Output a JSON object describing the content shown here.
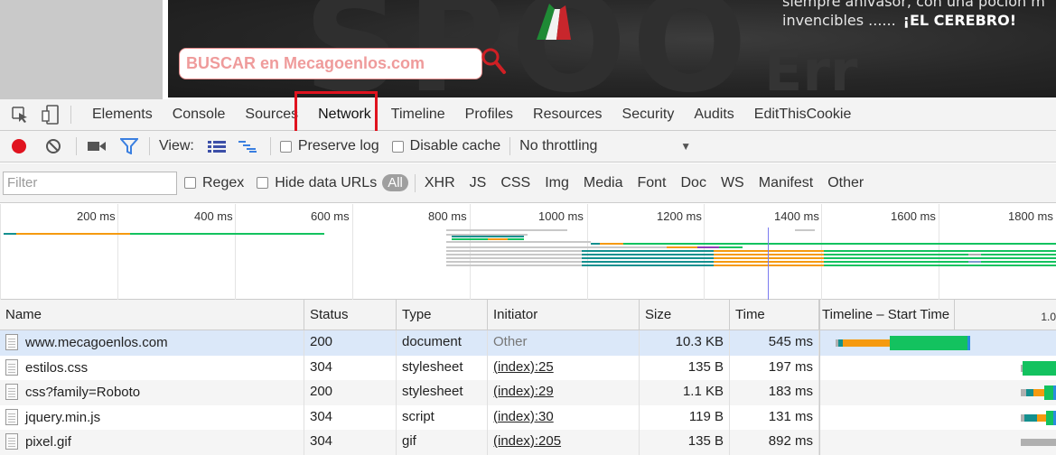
{
  "banner": {
    "bg_text": "SPOO",
    "bg_text2": "Err",
    "line1": "siempre ahivasor, con una pocion m",
    "line2": "invencibles ......",
    "line2_bold": "¡EL CEREBRO!",
    "search_value": "BUSCAR en Mecagoenlos.com"
  },
  "devtools_tabs": [
    "Elements",
    "Console",
    "Sources",
    "Network",
    "Timeline",
    "Profiles",
    "Resources",
    "Security",
    "Audits",
    "EditThisCookie"
  ],
  "active_tab": "Network",
  "toolbar": {
    "view_label": "View:",
    "preserve_log": "Preserve log",
    "disable_cache": "Disable cache",
    "throttling": "No throttling"
  },
  "filter": {
    "placeholder": "Filter",
    "regex": "Regex",
    "hide_data_urls": "Hide data URLs",
    "all": "All",
    "types": [
      "XHR",
      "JS",
      "CSS",
      "Img",
      "Media",
      "Font",
      "Doc",
      "WS",
      "Manifest",
      "Other"
    ]
  },
  "overview": {
    "ticks": [
      "200 ms",
      "400 ms",
      "600 ms",
      "800 ms",
      "1000 ms",
      "1200 ms",
      "1400 ms",
      "1600 ms",
      "1800 ms"
    ]
  },
  "table": {
    "columns": {
      "name": "Name",
      "status": "Status",
      "type": "Type",
      "initiator": "Initiator",
      "size": "Size",
      "time": "Time",
      "timeline": "Timeline – Start Time",
      "timeline_tick": "1.0"
    },
    "rows": [
      {
        "name": "www.mecagoenlos.com",
        "status": "200",
        "type": "document",
        "initiator": "Other",
        "size": "10.3 KB",
        "time": "545 ms"
      },
      {
        "name": "estilos.css",
        "status": "304",
        "type": "stylesheet",
        "initiator": "(index):25",
        "size": "135 B",
        "time": "197 ms"
      },
      {
        "name": "css?family=Roboto",
        "status": "200",
        "type": "stylesheet",
        "initiator": "(index):29",
        "size": "1.1 KB",
        "time": "183 ms"
      },
      {
        "name": "jquery.min.js",
        "status": "304",
        "type": "script",
        "initiator": "(index):30",
        "size": "119 B",
        "time": "131 ms"
      },
      {
        "name": "pixel.gif",
        "status": "304",
        "type": "gif",
        "initiator": "(index):205",
        "size": "135 B",
        "time": "892 ms"
      }
    ]
  },
  "colors": {
    "record": "#e0131f",
    "highlight": "#e0131f",
    "selected_row": "#dbe8f9",
    "filter_blue": "#3a7fe0",
    "waterfall_green": "#13c25f",
    "waterfall_orange": "#f59a10",
    "waterfall_teal": "#14908f",
    "waterfall_blue": "#2a8ce0",
    "waterfall_gray": "#b0b0b0"
  }
}
